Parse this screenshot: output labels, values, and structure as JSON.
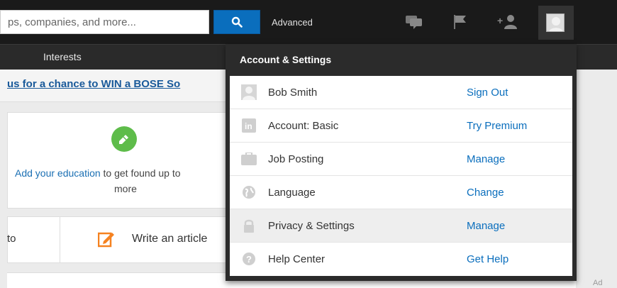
{
  "search": {
    "placeholder": "ps, companies, and more..."
  },
  "topbar": {
    "advanced_label": "Advanced"
  },
  "subnav": {
    "interests_label": "Interests"
  },
  "promo": {
    "text": "us for a chance to WIN a BOSE So"
  },
  "education": {
    "link": "Add your education",
    "rest": " to get found up to",
    "more": "more"
  },
  "actions": {
    "left_fragment": "to",
    "write_article": "Write an article"
  },
  "ad": {
    "label": "Ad"
  },
  "dropdown": {
    "title": "Account & Settings",
    "items": [
      {
        "label": "Bob Smith",
        "action": "Sign Out",
        "icon": "avatar-icon"
      },
      {
        "label": "Account: Basic",
        "action": "Try Premium",
        "icon": "linkedin-icon"
      },
      {
        "label": "Job Posting",
        "action": "Manage",
        "icon": "briefcase-icon"
      },
      {
        "label": "Language",
        "action": "Change",
        "icon": "globe-icon"
      },
      {
        "label": "Privacy & Settings",
        "action": "Manage",
        "icon": "lock-icon"
      },
      {
        "label": "Help Center",
        "action": "Get Help",
        "icon": "help-icon"
      }
    ]
  },
  "colors": {
    "accent": "#0a6ebd",
    "bar": "#1a1a1a",
    "success": "#5ebc4a",
    "orange": "#f58220"
  }
}
